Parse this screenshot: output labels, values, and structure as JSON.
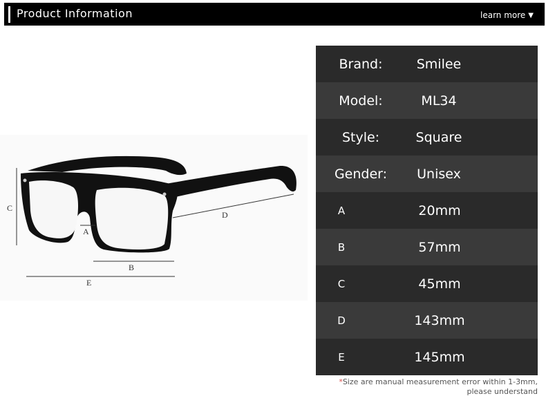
{
  "header": {
    "title": "Product Information",
    "learn_more": "learn more",
    "learn_more_caret": "▼"
  },
  "illustration": {
    "labels": {
      "a": "A",
      "b": "B",
      "c": "C",
      "d": "D",
      "e": "E"
    }
  },
  "specs": [
    {
      "key": "Brand:",
      "value": "Smilee"
    },
    {
      "key": "Model:",
      "value": "ML34"
    },
    {
      "key": "Style:",
      "value": "Square"
    },
    {
      "key": "Gender:",
      "value": "Unisex"
    },
    {
      "key": "A",
      "value": "20mm"
    },
    {
      "key": "B",
      "value": "57mm"
    },
    {
      "key": "C",
      "value": "45mm"
    },
    {
      "key": "D",
      "value": "143mm"
    },
    {
      "key": "E",
      "value": "145mm"
    }
  ],
  "footnote": {
    "star": "*",
    "line1": "Size are manual measurement error within 1-3mm,",
    "line2": "please understand"
  },
  "colors": {
    "header_bg": "#000000",
    "row_dark": "#2a2a2a",
    "row_light": "#3a3a3a",
    "text_light": "#ffffff"
  }
}
